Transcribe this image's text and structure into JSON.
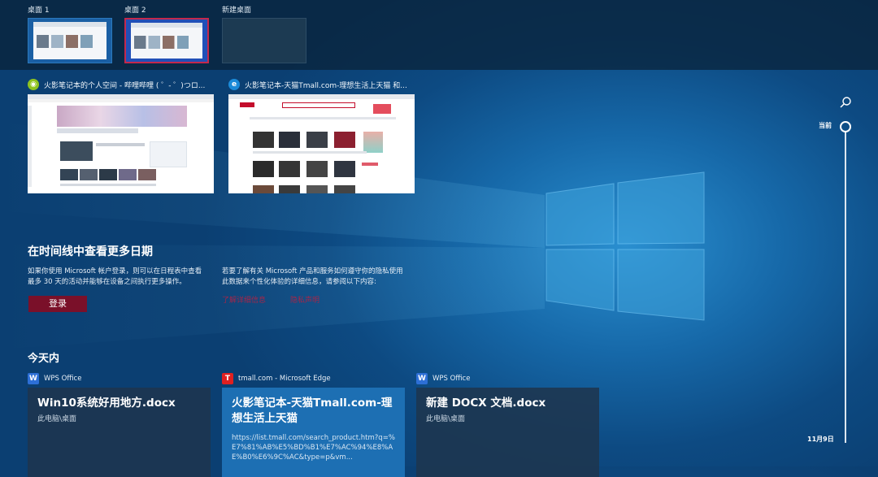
{
  "desktops": [
    {
      "label": "桌面 1"
    },
    {
      "label": "桌面 2"
    },
    {
      "label": "新建桌面"
    }
  ],
  "windows": [
    {
      "title": "火影笔记本的个人空间 - 哔哩哔哩 ( ゜- ゜)つロ...",
      "icon": "bilibili-app-icon"
    },
    {
      "title": "火影笔记本-天猫Tmall.com-理想生活上天猫 和...",
      "icon": "edge-browser-icon"
    }
  ],
  "timeline": {
    "heading": "在时间线中查看更多日期",
    "left_text": "如果你使用 Microsoft 帐户登录，则可以在日程表中查看最多 30 天的活动并能够在设备之间执行更多操作。",
    "right_text": "若要了解有关 Microsoft 产品和服务如何遵守你的隐私使用此数据来个性化体验的详细信息，请参阅以下内容:",
    "login_label": "登录",
    "link1": "了解详细信息",
    "link2": "隐私声明"
  },
  "today": {
    "heading": "今天内",
    "cards": [
      {
        "app": "WPS Office",
        "title": "Win10系统好用地方.docx",
        "sub": "此电脑\\桌面",
        "icon": "wps-office-icon"
      },
      {
        "app": "tmall.com - Microsoft Edge",
        "title": "火影笔记本-天猫Tmall.com-理想生活上天猫",
        "url": "https://list.tmall.com/search_product.htm?q=%E7%81%AB%E5%BD%B1%E7%AC%94%E8%AE%B0%E6%9C%AC&type=p&vm...",
        "icon": "tmall-icon"
      },
      {
        "app": "WPS Office",
        "title": "新建 DOCX 文档.docx",
        "sub": "此电脑\\桌面",
        "icon": "wps-office-icon"
      }
    ]
  },
  "rail": {
    "now_label": "当前",
    "date_label": "11月9日"
  },
  "colors": {
    "accent_login": "#7a1029",
    "link": "#a4264a",
    "card_highlight": "#1d6fb3",
    "selected_desktop_border": "#c4284c"
  }
}
